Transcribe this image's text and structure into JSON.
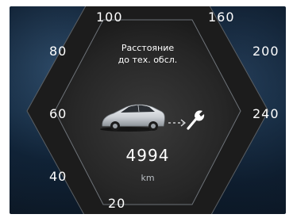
{
  "gauge": {
    "scale_labels": {
      "l100": "100",
      "l160": "160",
      "l80": "80",
      "l200": "200",
      "l60": "60",
      "l240": "240",
      "l40": "40",
      "l20": "20"
    }
  },
  "service": {
    "title_line1": "Расстояние",
    "title_line2": "до тех. обсл.",
    "distance": "4994",
    "unit": "km"
  },
  "icons": {
    "car": "car-icon",
    "arrow": "dashed-arrow-icon",
    "wrench": "wrench-icon"
  },
  "colors": {
    "background": "#0f1f2e",
    "panel": "#2c2c2c",
    "text": "#ffffff",
    "unit_text": "#b9bec3"
  }
}
